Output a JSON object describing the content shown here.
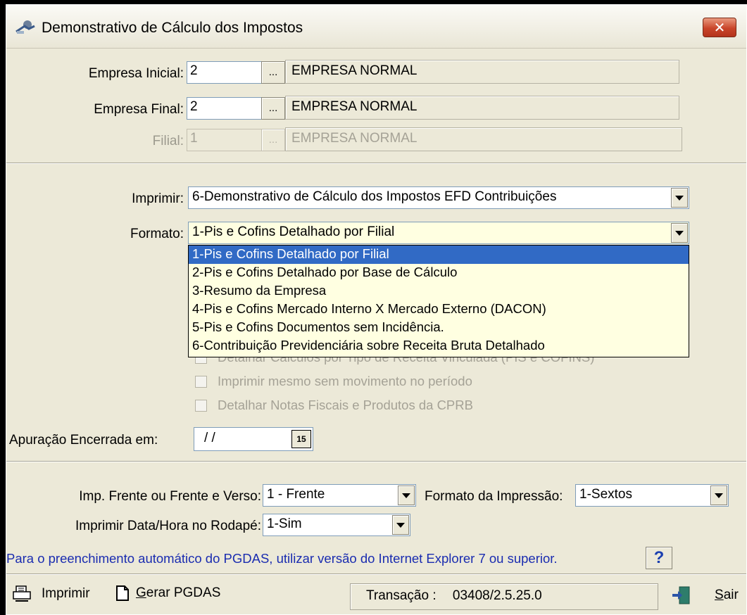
{
  "window": {
    "title": "Demonstrativo de Cálculo dos Impostos",
    "close_glyph": "✕"
  },
  "company": {
    "inicial": {
      "label": "Empresa Inicial:",
      "code": "2",
      "lookup": "...",
      "name": "EMPRESA NORMAL"
    },
    "final": {
      "label": "Empresa Final:",
      "code": "2",
      "lookup": "...",
      "name": "EMPRESA NORMAL"
    },
    "filial": {
      "label": "Filial:",
      "code": "1",
      "lookup": "...",
      "name": "EMPRESA NORMAL"
    }
  },
  "print": {
    "imprimir": {
      "label": "Imprimir:",
      "value": "6-Demonstrativo de Cálculo dos Impostos EFD Contribuições"
    },
    "formato": {
      "label": "Formato:",
      "value": "1-Pis e Cofins Detalhado por Filial"
    }
  },
  "formato_options": [
    "1-Pis e Cofins Detalhado por Filial",
    "2-Pis e Cofins Detalhado por Base de Cálculo",
    "3-Resumo da Empresa",
    "4-Pis e Cofins Mercado Interno X Mercado Externo (DACON)",
    "5-Pis e Cofins Documentos sem Incidência.",
    "6-Contribuição Previdenciária sobre Receita Bruta Detalhado"
  ],
  "options": {
    "hidden_partial": "Detalhar Cálculos por Tipo de Receita Vinculada (PIS e COFINS)",
    "sem_movimento": "Imprimir mesmo sem movimento no período",
    "detalhar_notas": "Detalhar Notas Fiscais e Produtos da CPRB"
  },
  "apuracao": {
    "label": "Apuração Encerrada em:",
    "value": "/ /",
    "cal": "15"
  },
  "bottom": {
    "frente_verso": {
      "label": "Imp. Frente ou Frente e Verso:",
      "value": "1 - Frente"
    },
    "formato_impressao": {
      "label": "Formato da Impressão:",
      "value": "1-Sextos"
    },
    "data_hora": {
      "label": "Imprimir Data/Hora no Rodapé:",
      "value": "1-Sim"
    }
  },
  "info": {
    "text": "Para o preenchimento automático do PGDAS, utilizar versão do Internet Explorer 7 ou superior.",
    "help": "?"
  },
  "toolbar": {
    "imprimir": "Imprimir",
    "gerar_pgdas_accel": "G",
    "gerar_pgdas_rest": "erar PGDAS",
    "transacao_label": "Transação :",
    "transacao_value": "03408/2.5.25.0",
    "sair_accel": "S",
    "sair_rest": "air"
  }
}
